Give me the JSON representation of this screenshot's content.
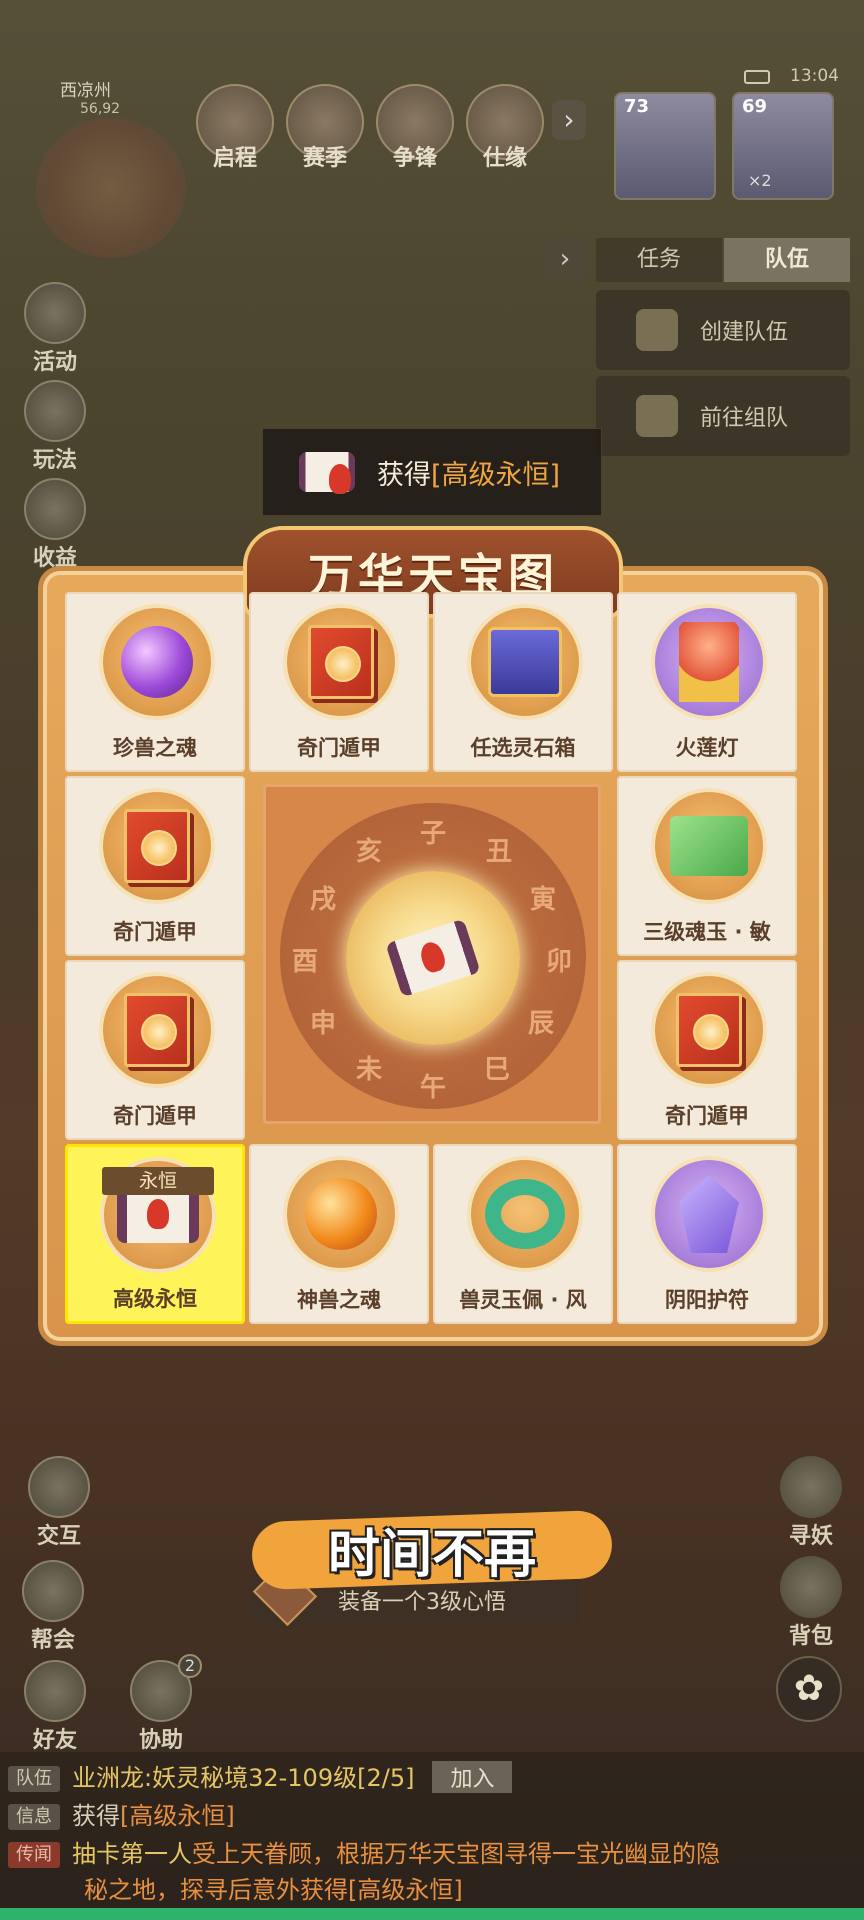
{
  "hud": {
    "location": "西凉州",
    "coords": "56,92",
    "time": "13:04",
    "top_buttons": [
      "启程",
      "赛季",
      "争锋",
      "仕缘"
    ],
    "portraits": [
      {
        "level": "73"
      },
      {
        "level": "69"
      }
    ],
    "portrait_count": "×2"
  },
  "team_panel": {
    "tabs": [
      "任务",
      "队伍"
    ],
    "active_tab": "队伍",
    "buttons": [
      "创建队伍",
      "前往组队"
    ]
  },
  "left_menu": [
    "活动",
    "玩法",
    "收益"
  ],
  "obtain_banner": {
    "prefix": "获得",
    "item": "[高级永恒]"
  },
  "board": {
    "title": "万华天宝图",
    "wheel_glyphs": [
      "子",
      "丑",
      "寅",
      "卯",
      "辰",
      "巳",
      "午",
      "未",
      "申",
      "酉",
      "戌",
      "亥"
    ],
    "cells": [
      {
        "label": "珍兽之魂",
        "icon": "purple-orb-icon"
      },
      {
        "label": "奇门遁甲",
        "icon": "red-book-icon"
      },
      {
        "label": "任选灵石箱",
        "icon": "gift-box-icon"
      },
      {
        "label": "火莲灯",
        "icon": "lotus-lamp-icon"
      },
      {
        "label": "奇门遁甲",
        "icon": "red-book-icon"
      },
      {
        "label": "三级魂玉 · 敏",
        "icon": "jade-tiles-icon"
      },
      {
        "label": "奇门遁甲",
        "icon": "red-book-icon"
      },
      {
        "label": "奇门遁甲",
        "icon": "red-book-icon"
      },
      {
        "label": "高级永恒",
        "icon": "scroll-icon",
        "badge": "永恒",
        "selected": true
      },
      {
        "label": "神兽之魂",
        "icon": "fire-orb-icon"
      },
      {
        "label": "兽灵玉佩 · 风",
        "icon": "jade-dragon-ring-icon"
      },
      {
        "label": "阴阳护符",
        "icon": "amulet-gem-icon"
      }
    ]
  },
  "subtitle": "时间不再",
  "quest": {
    "text": "装备一个3级心悟"
  },
  "bottom_left": [
    "交互",
    "帮会",
    "好友",
    "协助"
  ],
  "assist_badge": "2",
  "right_menu": [
    "寻妖",
    "背包"
  ],
  "chat": [
    {
      "tag": "队伍",
      "text_a": "业洲龙:",
      "text_b": "妖灵秘境32-109级[2/5]",
      "action": "加入"
    },
    {
      "tag": "信息",
      "text_a": "获得",
      "text_b": "[高级永恒]"
    },
    {
      "tag": "传闻",
      "line1_a": "抽卡第一人",
      "line1_b": "受上天眷顾，根据万华天宝图寻得一宝光幽显的隐",
      "line2_a": "秘之地，探寻后意外获得",
      "line2_b": "[高级永恒]"
    }
  ],
  "colors": {
    "accent": "#f0a640",
    "highlight": "#fff35a",
    "frame": "#d9944a"
  }
}
